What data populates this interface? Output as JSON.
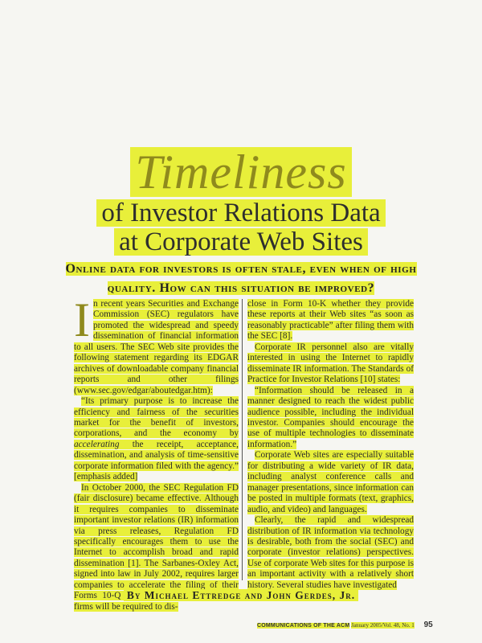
{
  "title": {
    "main": "Timeliness",
    "line1": "of Investor Relations Data",
    "line2": "at Corporate Web Sites"
  },
  "deck": "Online data for investors is often stale, even when of high quality. How can this situation be improved?",
  "left_column": {
    "dropcap": "I",
    "p1": "n recent years Securities and Exchange Commission (SEC) regulators have promoted the widespread and speedy dissemination of financial information to all users. The SEC Web site provides the following statement regarding its EDGAR archives of downloadable company financial reports and other filings (www.sec.gov/edgar/aboutedgar.htm):",
    "p2a": "“Its primary purpose is to increase the efficiency and fairness of the securities market for the benefit of investors, corporations, and the economy by ",
    "p2b": "accelerating",
    "p2c": " the receipt, acceptance, dissemination, and analysis of time-sensitive corporate information filed with the agency.” [emphasis added]",
    "p3": "In October 2000, the SEC Regulation FD (fair disclosure) became effective. Although it requires companies to disseminate important investor relations (IR) information via press releases, Regulation FD specifically encourages them to use the Internet to accomplish broad and rapid dissemination [1]. The Sarbanes-Oxley Act, signed into law in July 2002, requires larger companies to accelerate the filing of their Forms 10-Q and 10-K. In addition, these firms will be required to dis-"
  },
  "right_column": {
    "p1": "close in Form 10-K whether they provide these reports at their Web sites “as soon as reasonably practicable” after filing them with the SEC [8].",
    "p2": "Corporate IR personnel also are vitally interested in using the Internet to rapidly disseminate IR information. The Standards of Practice for Investor Relations [10] states:",
    "p3": "“Information should be released in a manner designed to reach the widest public audience possible, including the individual investor. Companies should encourage the use of multiple technologies to disseminate information.”",
    "p4": "Corporate Web sites are especially suitable for distributing a wide variety of IR data, including analyst conference calls and manager presentations, since information can be posted in multiple formats (text, graphics, audio, and video) and languages.",
    "p5": "Clearly, the rapid and widespread distribution of IR information via technology is desirable, both from the social (SEC) and corporate (investor relations) perspectives. Use of corporate Web sites for this purpose is an important activity with a relatively short history. Several studies have investigated"
  },
  "byline": "By Michael Ettredge and John Gerdes, Jr.",
  "footer": {
    "publication": "COMMUNICATIONS OF THE ACM",
    "issue": "January 2005/Vol. 48, No. 1",
    "page": "95"
  },
  "colors": {
    "highlight": "#e8ef3a",
    "title_olive": "#8f8a1d",
    "paper": "#f6f6f2"
  }
}
